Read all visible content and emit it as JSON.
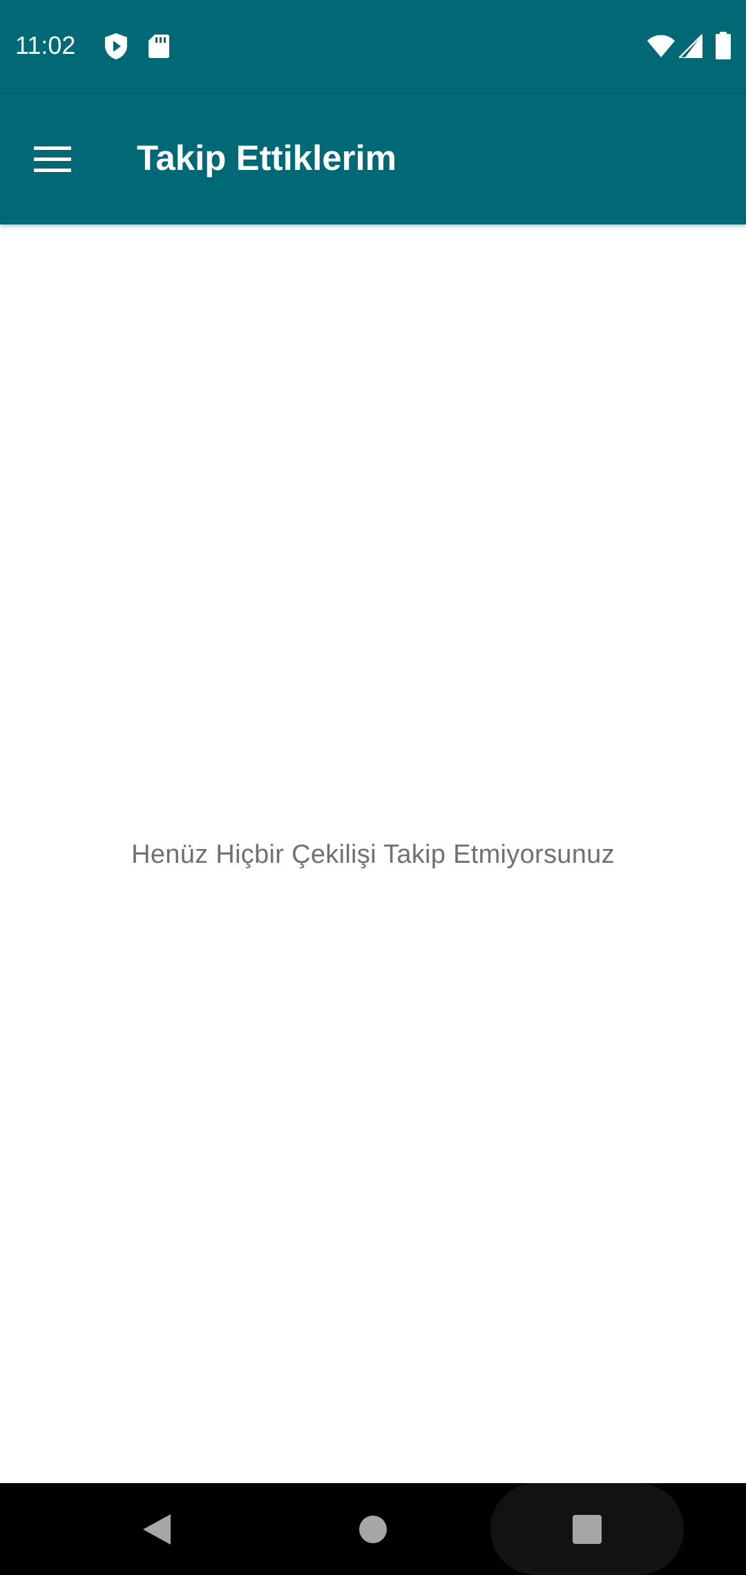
{
  "status_bar": {
    "time": "11:02",
    "left_icons": [
      "shield-play-icon",
      "sd-card-icon"
    ],
    "right_icons": [
      "wifi-icon",
      "cell-signal-icon",
      "battery-icon"
    ]
  },
  "app_bar": {
    "title": "Takip Ettiklerim",
    "menu_icon": "hamburger-menu-icon",
    "background_color": "#016876"
  },
  "content": {
    "empty_message": "Henüz Hiçbir Çekilişi Takip Etmiyorsunuz"
  },
  "nav_bar": {
    "buttons": [
      "back-icon",
      "home-icon",
      "recents-icon"
    ]
  }
}
